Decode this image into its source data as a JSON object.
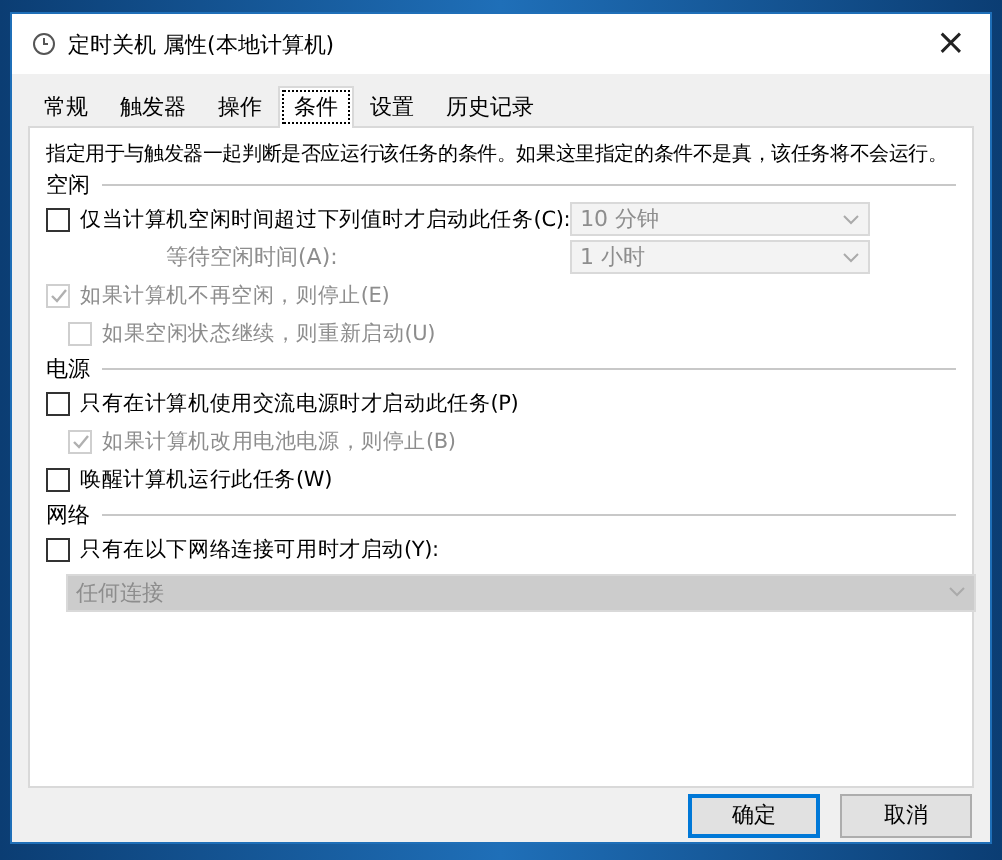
{
  "window": {
    "title": "定时关机 属性(本地计算机)",
    "close": "×"
  },
  "tabs": [
    {
      "label": "常规",
      "selected": false
    },
    {
      "label": "触发器",
      "selected": false
    },
    {
      "label": "操作",
      "selected": false
    },
    {
      "label": "条件",
      "selected": true
    },
    {
      "label": "设置",
      "selected": false
    },
    {
      "label": "历史记录",
      "selected": false
    }
  ],
  "description": "指定用于与触发器一起判断是否应运行该任务的条件。如果这里指定的条件不是真，该任务将不会运行。",
  "sections": [
    {
      "title": "空闲",
      "items": [
        {
          "kind": "checkbox",
          "label": "仅当计算机空闲时间超过下列值时才启动此任务(C):",
          "checked": false,
          "disabled": false,
          "dropdown": {
            "value": "10 分钟",
            "disabled": true
          }
        },
        {
          "kind": "labeled_dropdown",
          "label": "等待空闲时间(A):",
          "disabled": true,
          "dropdown": {
            "value": "1 小时",
            "disabled": true
          }
        },
        {
          "kind": "checkbox",
          "label": "如果计算机不再空闲，则停止(E)",
          "checked": true,
          "disabled": true,
          "children": [
            {
              "kind": "checkbox",
              "label": "如果空闲状态继续，则重新启动(U)",
              "checked": false,
              "disabled": true
            }
          ]
        }
      ]
    },
    {
      "title": "电源",
      "items": [
        {
          "kind": "checkbox",
          "label": "只有在计算机使用交流电源时才启动此任务(P)",
          "checked": false,
          "disabled": false,
          "children": [
            {
              "kind": "checkbox",
              "label": "如果计算机改用电池电源，则停止(B)",
              "checked": true,
              "disabled": true
            }
          ]
        },
        {
          "kind": "checkbox",
          "label": "唤醒计算机运行此任务(W)",
          "checked": false,
          "disabled": false
        }
      ]
    },
    {
      "title": "网络",
      "items": [
        {
          "kind": "checkbox",
          "label": "只有在以下网络连接可用时才启动(Y):",
          "checked": false,
          "disabled": false
        },
        {
          "kind": "wide_dropdown",
          "dropdown": {
            "value": "任何连接",
            "disabled": true
          }
        }
      ]
    }
  ],
  "buttons": [
    {
      "label": "确定",
      "default": true
    },
    {
      "label": "取消",
      "default": false
    }
  ]
}
